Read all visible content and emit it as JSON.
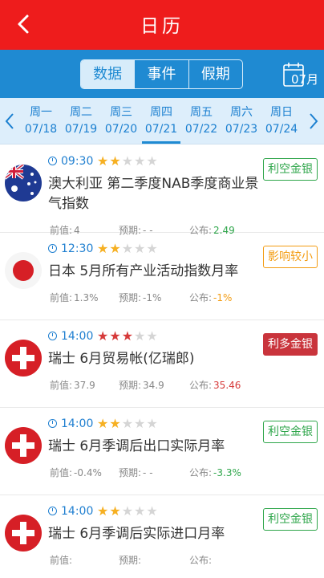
{
  "header": {
    "title": "日历"
  },
  "tabs": [
    {
      "label": "数据",
      "active": true
    },
    {
      "label": "事件",
      "active": false
    },
    {
      "label": "假期",
      "active": false
    }
  ],
  "calendar_button": {
    "month": "07月"
  },
  "week": [
    {
      "weekday": "周一",
      "date": "07/18"
    },
    {
      "weekday": "周二",
      "date": "07/19"
    },
    {
      "weekday": "周三",
      "date": "07/20"
    },
    {
      "weekday": "周四",
      "date": "07/21",
      "active": true
    },
    {
      "weekday": "周五",
      "date": "07/22"
    },
    {
      "weekday": "周六",
      "date": "07/23"
    },
    {
      "weekday": "周日",
      "date": "07/24"
    }
  ],
  "labels": {
    "prev": "前值:",
    "forecast": "预期:",
    "actual": "公布:"
  },
  "events": [
    {
      "country": "australia",
      "time": "09:30",
      "stars": 2,
      "star_color": "#f6b022",
      "title": "澳大利亚 第二季度NAB季度商业景气指数",
      "badge": "利空金银",
      "badge_style": "green",
      "prev": "4",
      "forecast": "- -",
      "actual": "2.49",
      "actual_color": "#2fa64b"
    },
    {
      "country": "japan",
      "time": "12:30",
      "stars": 2,
      "star_color": "#f6b022",
      "title": "日本 5月所有产业活动指数月率",
      "badge": "影响较小",
      "badge_style": "orange",
      "prev": "1.3%",
      "forecast": "-1%",
      "actual": "-1%",
      "actual_color": "#f39c12"
    },
    {
      "country": "switzerland",
      "time": "14:00",
      "stars": 3,
      "star_color": "#d63a3a",
      "title": "瑞士 6月贸易帐(亿瑞郎)",
      "badge": "利多金银",
      "badge_style": "redfill",
      "prev": "37.9",
      "forecast": "34.9",
      "actual": "35.46",
      "actual_color": "#d63a3a"
    },
    {
      "country": "switzerland",
      "time": "14:00",
      "stars": 2,
      "star_color": "#f6b022",
      "title": "瑞士 6月季调后出口实际月率",
      "badge": "利空金银",
      "badge_style": "green",
      "prev": "-0.4%",
      "forecast": "- -",
      "actual": "-3.3%",
      "actual_color": "#2fa64b"
    },
    {
      "country": "switzerland",
      "time": "14:00",
      "stars": 2,
      "star_color": "#f6b022",
      "title": "瑞士 6月季调后实际进口月率",
      "badge": "利空金银",
      "badge_style": "green",
      "prev": "",
      "forecast": "",
      "actual": "",
      "actual_color": "#2fa64b"
    }
  ]
}
